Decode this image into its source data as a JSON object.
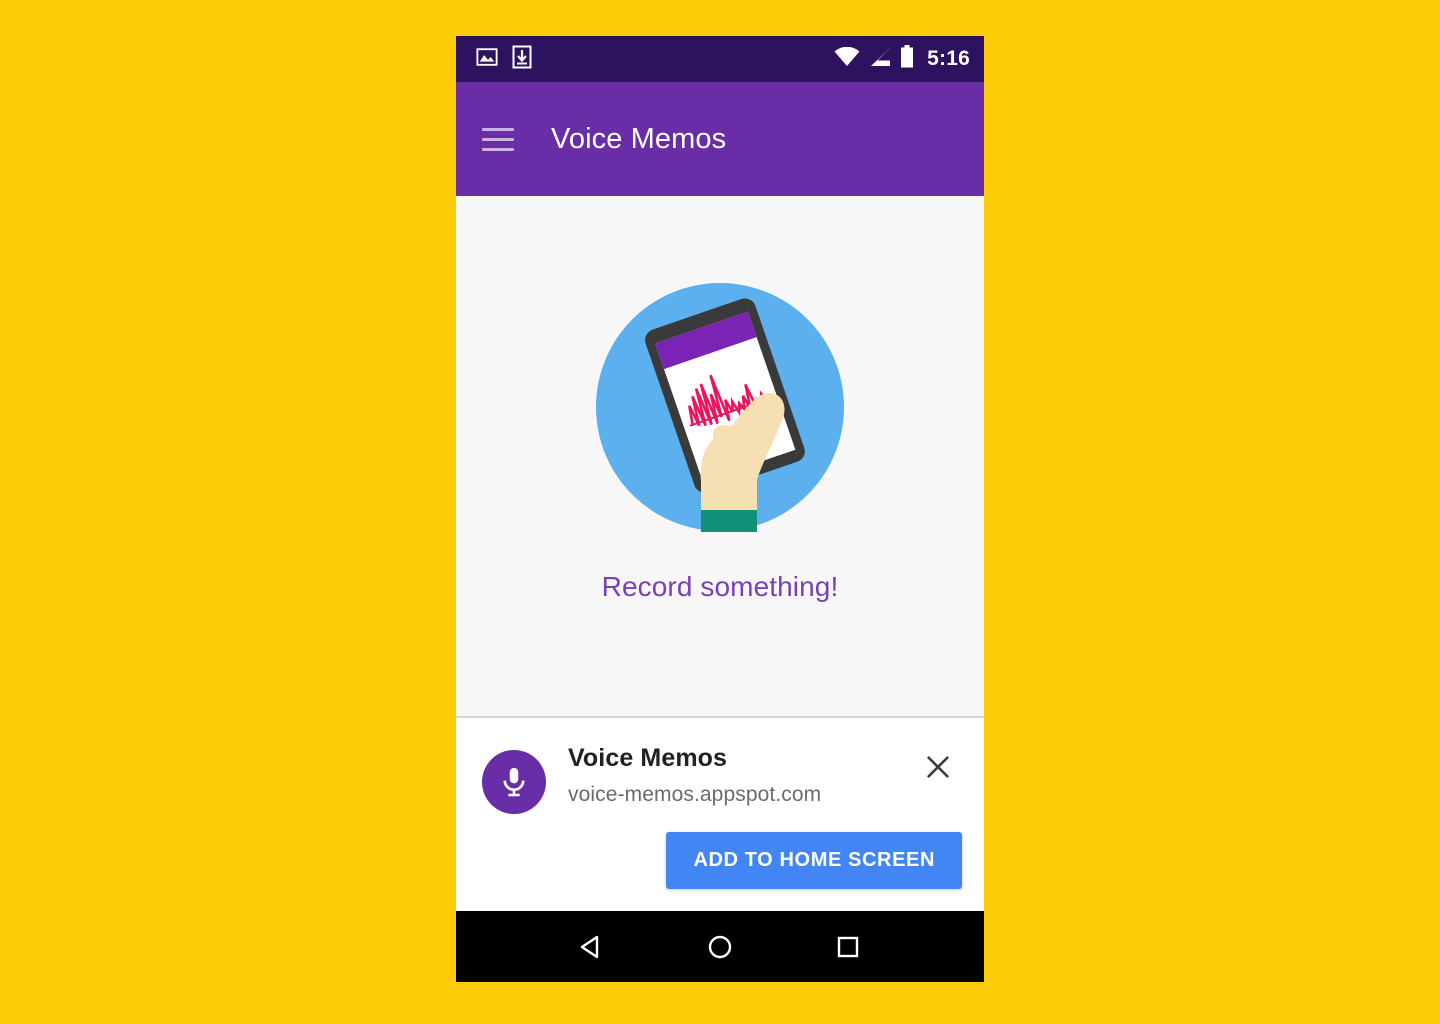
{
  "page": {
    "background_color": "#FDCC09"
  },
  "status_bar": {
    "background_color": "#2D1260",
    "time": "5:16",
    "left_icons": [
      {
        "name": "image-icon",
        "label": "Screenshot saved"
      },
      {
        "name": "download-icon",
        "label": "Download complete"
      }
    ],
    "right_icons": [
      {
        "name": "wifi-icon",
        "label": "Wi-Fi"
      },
      {
        "name": "cellular-signal-icon",
        "label": "Mobile signal"
      },
      {
        "name": "battery-icon",
        "label": "Battery"
      }
    ]
  },
  "app_bar": {
    "background_color": "#6A2DA8",
    "title": "Voice Memos",
    "menu_label": "Open navigation menu"
  },
  "content": {
    "background_color": "#F7F7F7",
    "empty_state_text": "Record something!",
    "empty_state_text_color": "#7B3FB8",
    "illustration": {
      "name": "hand-holding-phone-illustration",
      "circle_color": "#5BB0ED",
      "phone_body_color": "#3A3A3A",
      "phone_screen_color": "#FFFFFF",
      "phone_header_color": "#7B23B5",
      "waveform_color": "#E8155F",
      "skin_color": "#F6DFB2",
      "sleeve_color": "#139178"
    }
  },
  "install_banner": {
    "background_color": "#FFFFFF",
    "app_icon_name": "microphone-icon",
    "app_icon_color": "#6A2DA8",
    "title": "Voice Memos",
    "url": "voice-memos.appspot.com",
    "close_label": "Dismiss",
    "add_button_label": "ADD TO HOME SCREEN",
    "add_button_color": "#4285F4"
  },
  "nav_bar": {
    "background_color": "#000000",
    "buttons": [
      {
        "name": "back-button",
        "label": "Back"
      },
      {
        "name": "home-button",
        "label": "Home"
      },
      {
        "name": "recents-button",
        "label": "Recent apps"
      }
    ]
  }
}
